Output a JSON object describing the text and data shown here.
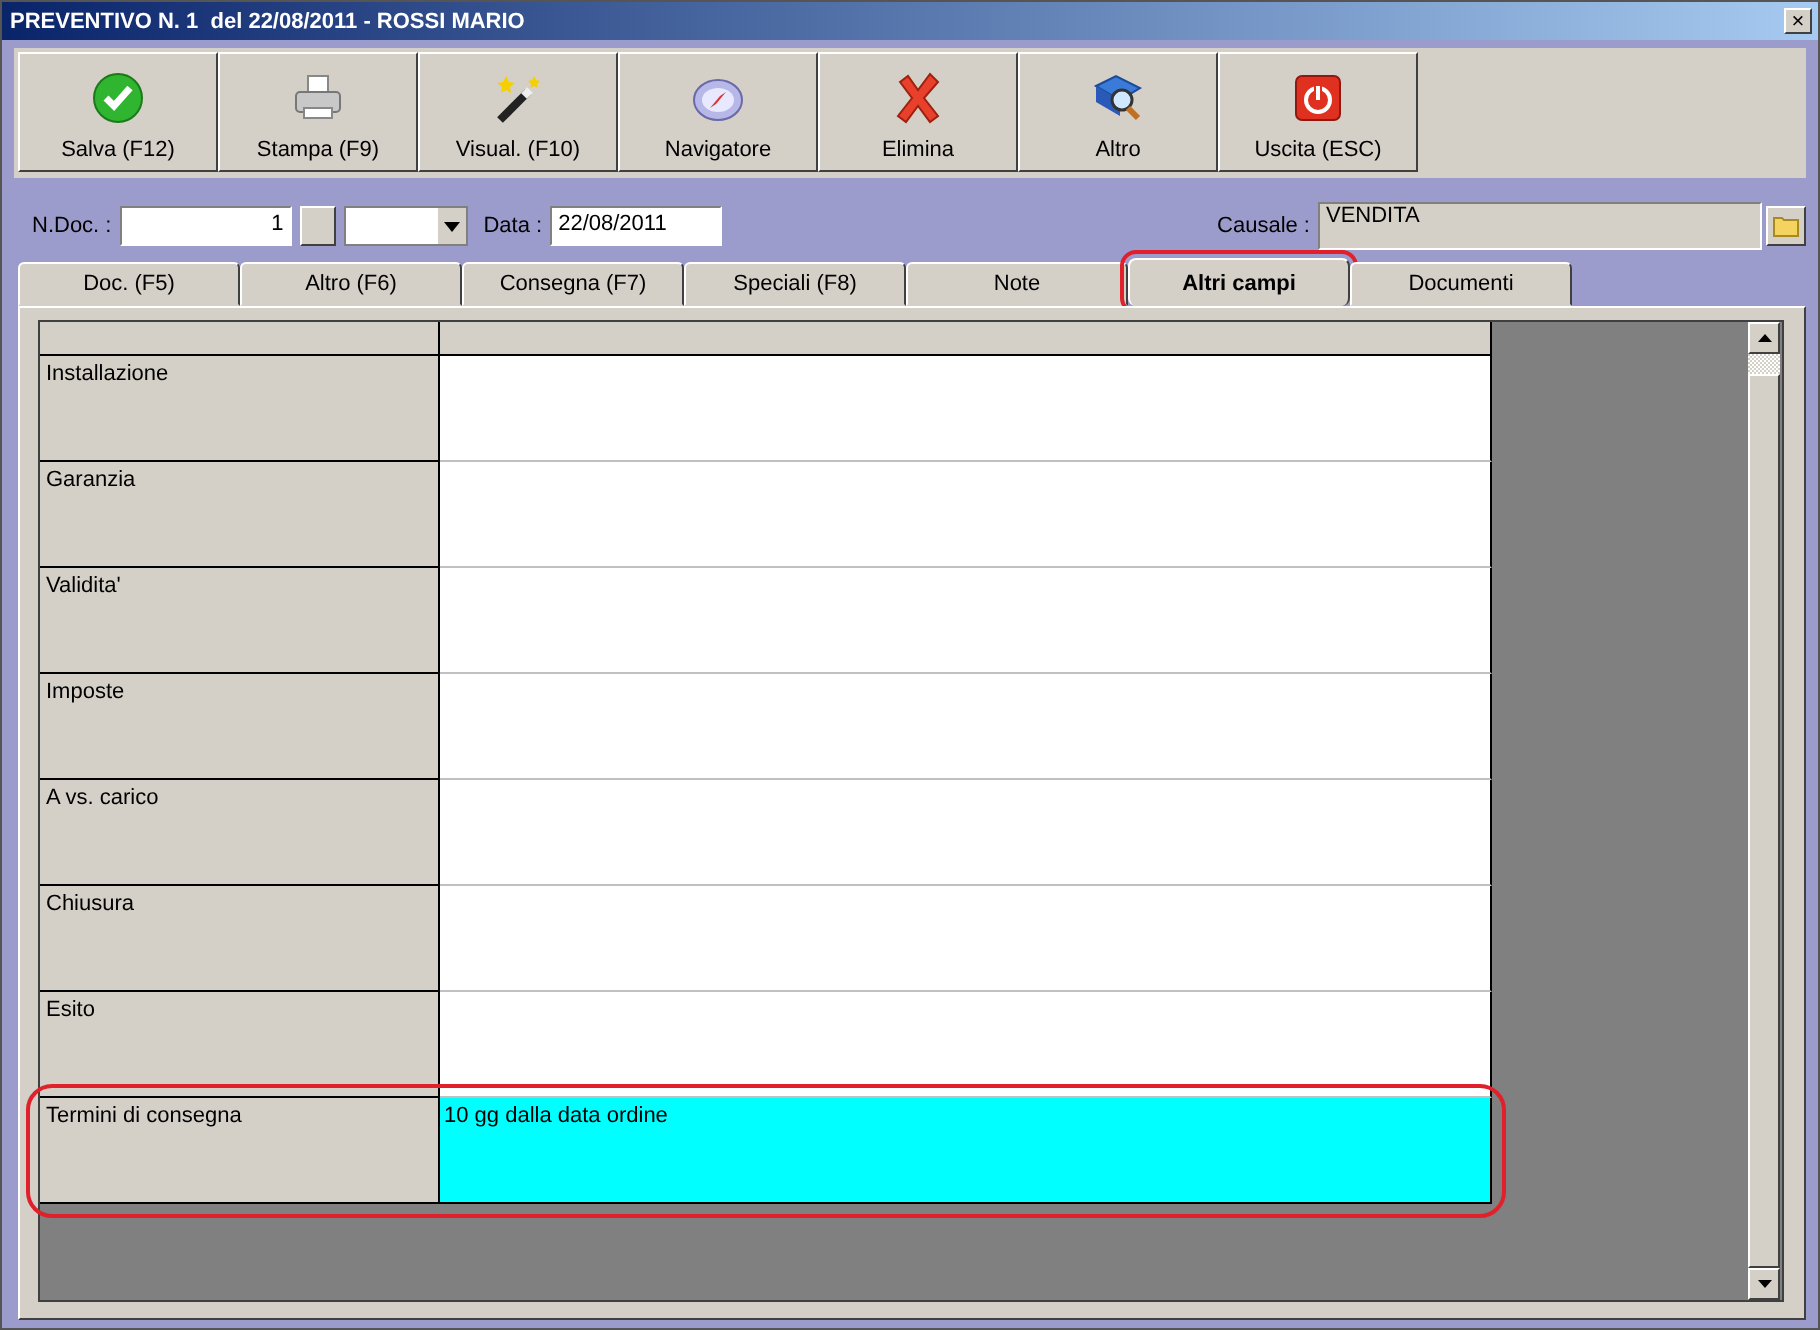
{
  "window": {
    "title": "PREVENTIVO N. 1  del 22/08/2011 - ROSSI MARIO",
    "close": "×"
  },
  "toolbar": [
    {
      "label": "Salva (F12)",
      "kind": "check"
    },
    {
      "label": "Stampa (F9)",
      "kind": "printer"
    },
    {
      "label": "Visual. (F10)",
      "kind": "wand"
    },
    {
      "label": "Navigatore",
      "kind": "compass"
    },
    {
      "label": "Elimina",
      "kind": "cross"
    },
    {
      "label": "Altro",
      "kind": "book"
    },
    {
      "label": "Uscita (ESC)",
      "kind": "power"
    }
  ],
  "form": {
    "ndoc_label": "N.Doc. :",
    "ndoc_value": "1",
    "data_label": "Data :",
    "data_value": "22/08/2011",
    "causale_label": "Causale :",
    "causale_value": "VENDITA"
  },
  "tabs": [
    {
      "label": "Doc. (F5)",
      "selected": false,
      "highlighted": false
    },
    {
      "label": "Altro (F6)",
      "selected": false,
      "highlighted": false
    },
    {
      "label": "Consegna (F7)",
      "selected": false,
      "highlighted": false
    },
    {
      "label": "Speciali (F8)",
      "selected": false,
      "highlighted": false
    },
    {
      "label": "Note",
      "selected": false,
      "highlighted": false
    },
    {
      "label": "Altri campi",
      "selected": true,
      "highlighted": true
    },
    {
      "label": "Documenti",
      "selected": false,
      "highlighted": false
    }
  ],
  "table": {
    "rows": [
      {
        "label": "Installazione",
        "value": "",
        "selected": false,
        "highlighted": false
      },
      {
        "label": "Garanzia",
        "value": "",
        "selected": false,
        "highlighted": false
      },
      {
        "label": "Validita'",
        "value": "",
        "selected": false,
        "highlighted": false
      },
      {
        "label": "Imposte",
        "value": "",
        "selected": false,
        "highlighted": false
      },
      {
        "label": "A vs. carico",
        "value": "",
        "selected": false,
        "highlighted": false
      },
      {
        "label": "Chiusura",
        "value": "",
        "selected": false,
        "highlighted": false
      },
      {
        "label": "Esito",
        "value": "",
        "selected": false,
        "highlighted": false
      },
      {
        "label": "Termini di consegna",
        "value": "10 gg dalla data ordine",
        "selected": true,
        "highlighted": true
      }
    ]
  }
}
